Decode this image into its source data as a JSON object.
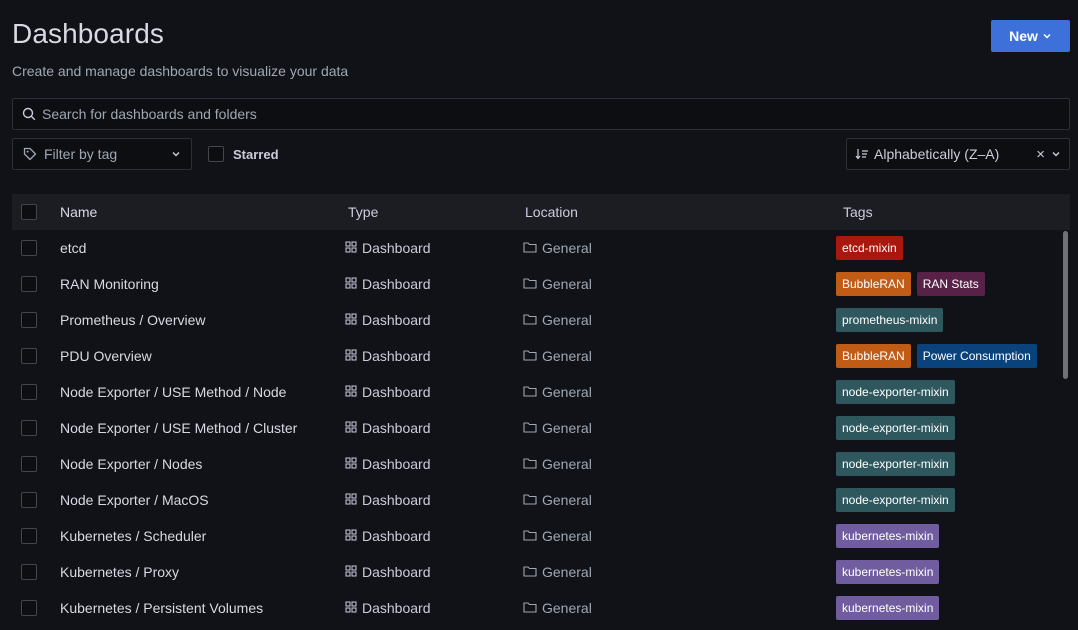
{
  "header": {
    "title": "Dashboards",
    "subtitle": "Create and manage dashboards to visualize your data",
    "new_label": "New"
  },
  "search": {
    "placeholder": "Search for dashboards and folders"
  },
  "filters": {
    "tag_placeholder": "Filter by tag",
    "starred_label": "Starred",
    "sort_value": "Alphabetically (Z–A)"
  },
  "table": {
    "columns": {
      "name": "Name",
      "type": "Type",
      "location": "Location",
      "tags": "Tags"
    },
    "rows": [
      {
        "name": "etcd",
        "type": "Dashboard",
        "location": "General",
        "tags": [
          {
            "label": "etcd-mixin",
            "color": "#a8180f"
          }
        ]
      },
      {
        "name": "RAN Monitoring",
        "type": "Dashboard",
        "location": "General",
        "tags": [
          {
            "label": "BubbleRAN",
            "color": "#c15c17"
          },
          {
            "label": "RAN Stats",
            "color": "#582147"
          }
        ]
      },
      {
        "name": "Prometheus / Overview",
        "type": "Dashboard",
        "location": "General",
        "tags": [
          {
            "label": "prometheus-mixin",
            "color": "#2f575e"
          }
        ]
      },
      {
        "name": "PDU Overview",
        "type": "Dashboard",
        "location": "General",
        "tags": [
          {
            "label": "BubbleRAN",
            "color": "#c15c17"
          },
          {
            "label": "Power Consumption",
            "color": "#0a437c"
          }
        ]
      },
      {
        "name": "Node Exporter / USE Method / Node",
        "type": "Dashboard",
        "location": "General",
        "tags": [
          {
            "label": "node-exporter-mixin",
            "color": "#2f575e"
          }
        ]
      },
      {
        "name": "Node Exporter / USE Method / Cluster",
        "type": "Dashboard",
        "location": "General",
        "tags": [
          {
            "label": "node-exporter-mixin",
            "color": "#2f575e"
          }
        ]
      },
      {
        "name": "Node Exporter / Nodes",
        "type": "Dashboard",
        "location": "General",
        "tags": [
          {
            "label": "node-exporter-mixin",
            "color": "#2f575e"
          }
        ]
      },
      {
        "name": "Node Exporter / MacOS",
        "type": "Dashboard",
        "location": "General",
        "tags": [
          {
            "label": "node-exporter-mixin",
            "color": "#2f575e"
          }
        ]
      },
      {
        "name": "Kubernetes / Scheduler",
        "type": "Dashboard",
        "location": "General",
        "tags": [
          {
            "label": "kubernetes-mixin",
            "color": "#705da0"
          }
        ]
      },
      {
        "name": "Kubernetes / Proxy",
        "type": "Dashboard",
        "location": "General",
        "tags": [
          {
            "label": "kubernetes-mixin",
            "color": "#705da0"
          }
        ]
      },
      {
        "name": "Kubernetes / Persistent Volumes",
        "type": "Dashboard",
        "location": "General",
        "tags": [
          {
            "label": "kubernetes-mixin",
            "color": "#705da0"
          }
        ]
      }
    ]
  }
}
